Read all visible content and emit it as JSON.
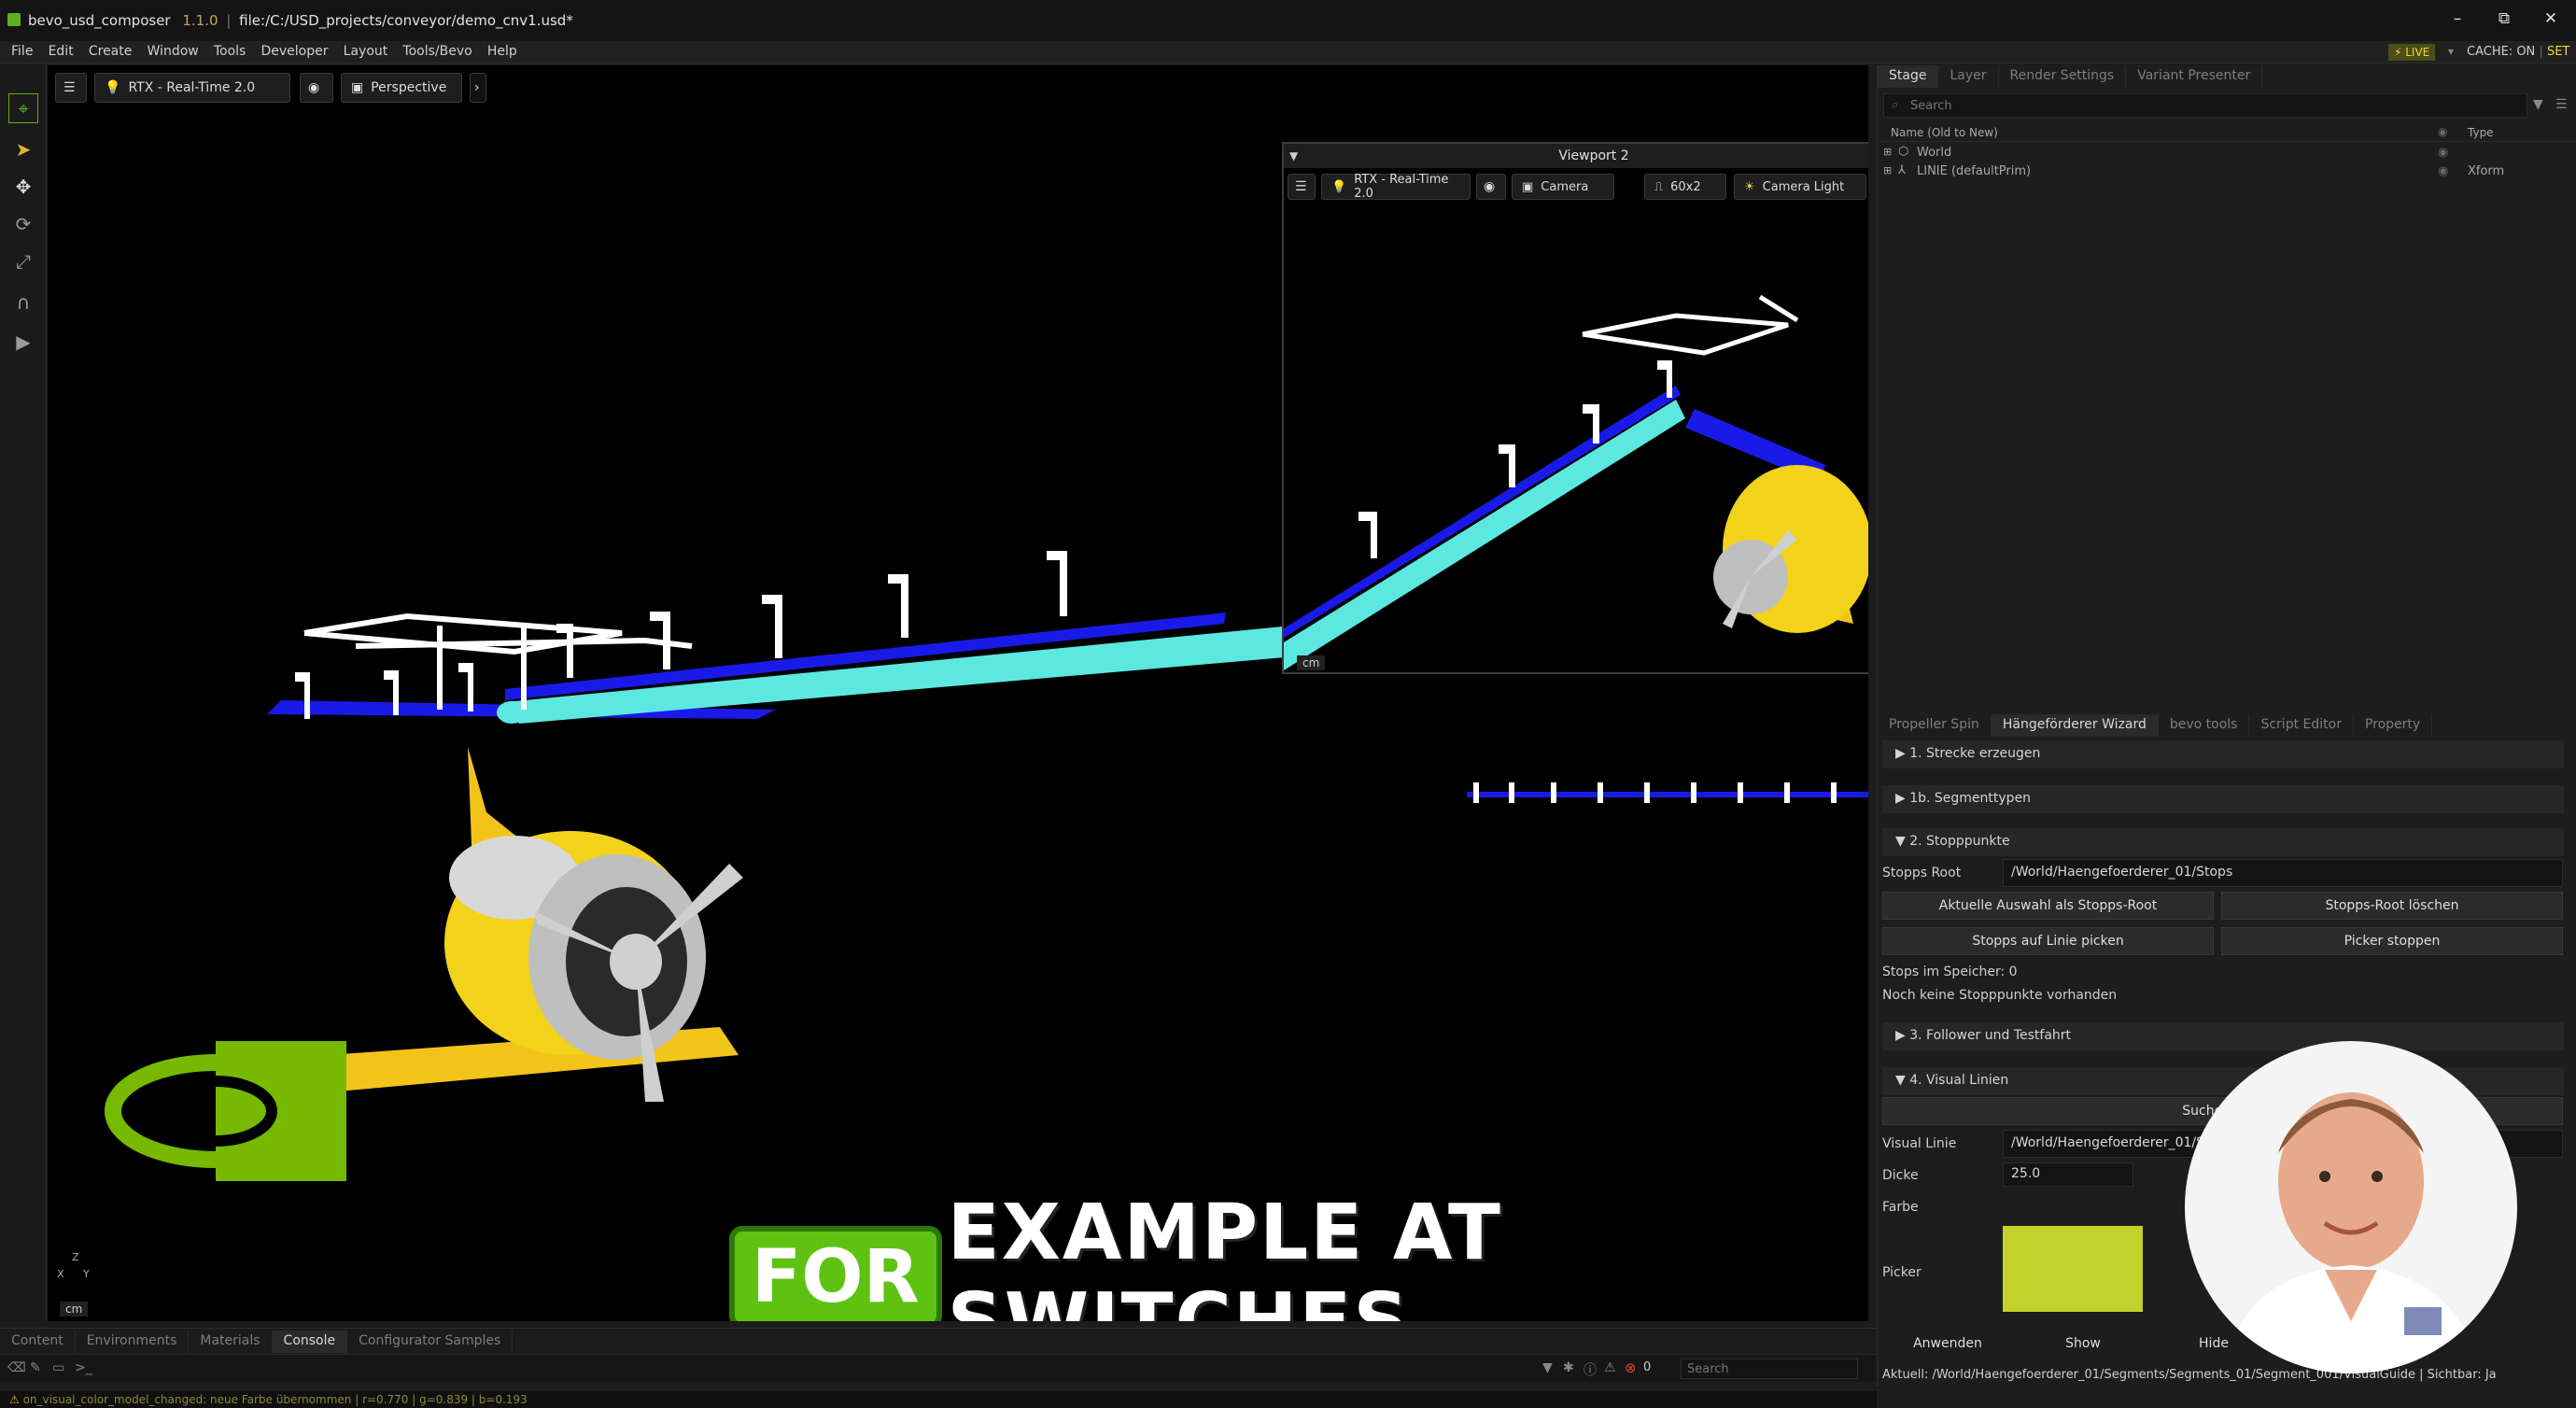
{
  "titlebar": {
    "app_name": "bevo_usd_composer",
    "version": "1.1.0",
    "file_path": "file:/C:/USD_projects/conveyor/demo_cnv1.usd*",
    "minimize": "–",
    "restore": "⧉",
    "close": "✕"
  },
  "menu": {
    "items": [
      "File",
      "Edit",
      "Create",
      "Window",
      "Tools",
      "Developer",
      "Layout",
      "Tools/Bevo",
      "Help"
    ],
    "live": "⚡ LIVE",
    "cache": "CACHE: ON",
    "set": "SET"
  },
  "viewport": {
    "renderer": "RTX - Real-Time 2.0",
    "camera": "Perspective",
    "unit": "cm",
    "axis_y": "Y",
    "axis_x": "X",
    "axis_z": "Z"
  },
  "viewport2": {
    "title": "Viewport 2",
    "renderer": "RTX - Real-Time 2.0",
    "camera": "Camera",
    "fps": "60x2",
    "light": "Camera Light",
    "unit": "cm"
  },
  "stage": {
    "tabs": [
      "Stage",
      "Layer",
      "Render Settings",
      "Variant Presenter"
    ],
    "search_placeholder": "Search",
    "col_name": "Name (Old to New)",
    "col_type": "Type",
    "rows": [
      {
        "name": "World",
        "type": ""
      },
      {
        "name": "LINIE (defaultPrim)",
        "type": "Xform"
      }
    ]
  },
  "wizard": {
    "tabs": [
      "Propeller Spin",
      "Hängeförderer Wizard",
      "bevo tools",
      "Script Editor",
      "Property"
    ],
    "sections": {
      "s1": "▶  1. Strecke erzeugen",
      "s1b": "▶  1b. Segmenttypen",
      "s2": "▼  2. Stopppunkte",
      "s3": "▶  3. Follower und Testfahrt",
      "s4": "▼  4. Visual Linien"
    },
    "stopps_root_label": "Stopps Root",
    "stopps_root_value": "/World/Haengefoerderer_01/Stops",
    "btn_set_root": "Aktuelle Auswahl als Stopps-Root",
    "btn_delete_root": "Stopps-Root löschen",
    "btn_pick": "Stopps auf Linie picken",
    "btn_stop_picker": "Picker stoppen",
    "stops_in_memory": "Stops im Speicher: 0",
    "no_stops": "Noch keine Stopppunkte vorhanden",
    "search_all": "Suche alle V",
    "visual_linie_label": "Visual Linie",
    "visual_linie_value": "/World/Haengefoerderer_01/Seg",
    "dicke_label": "Dicke",
    "dicke_value": "25.0",
    "farbe_label": "Farbe",
    "picker_label": "Picker",
    "picker_color": "#c2d12b",
    "btn_apply": "Anwenden",
    "btn_show": "Show",
    "btn_hide": "Hide",
    "current": "Aktuell: /World/Haengefoerderer_01/Segments/Segments_01/Segment_001/VisualGuide | Sichtbar: Ja"
  },
  "bottom": {
    "tabs": [
      "Content",
      "Environments",
      "Materials",
      "Console",
      "Configurator Samples"
    ],
    "search_placeholder": "Search",
    "error_count": "0",
    "status": "on_visual_color_model_changed: neue Farbe übernommen | r=0.770 | g=0.839 | b=0.193"
  },
  "caption": {
    "boxed": "FOR",
    "rest": "EXAMPLE AT SWITCHES"
  },
  "colors": {
    "rail": "#5ce8e0",
    "rail_blue": "#1a1ae8",
    "plane": "#f2d21a",
    "nvidia": "#76b900"
  }
}
